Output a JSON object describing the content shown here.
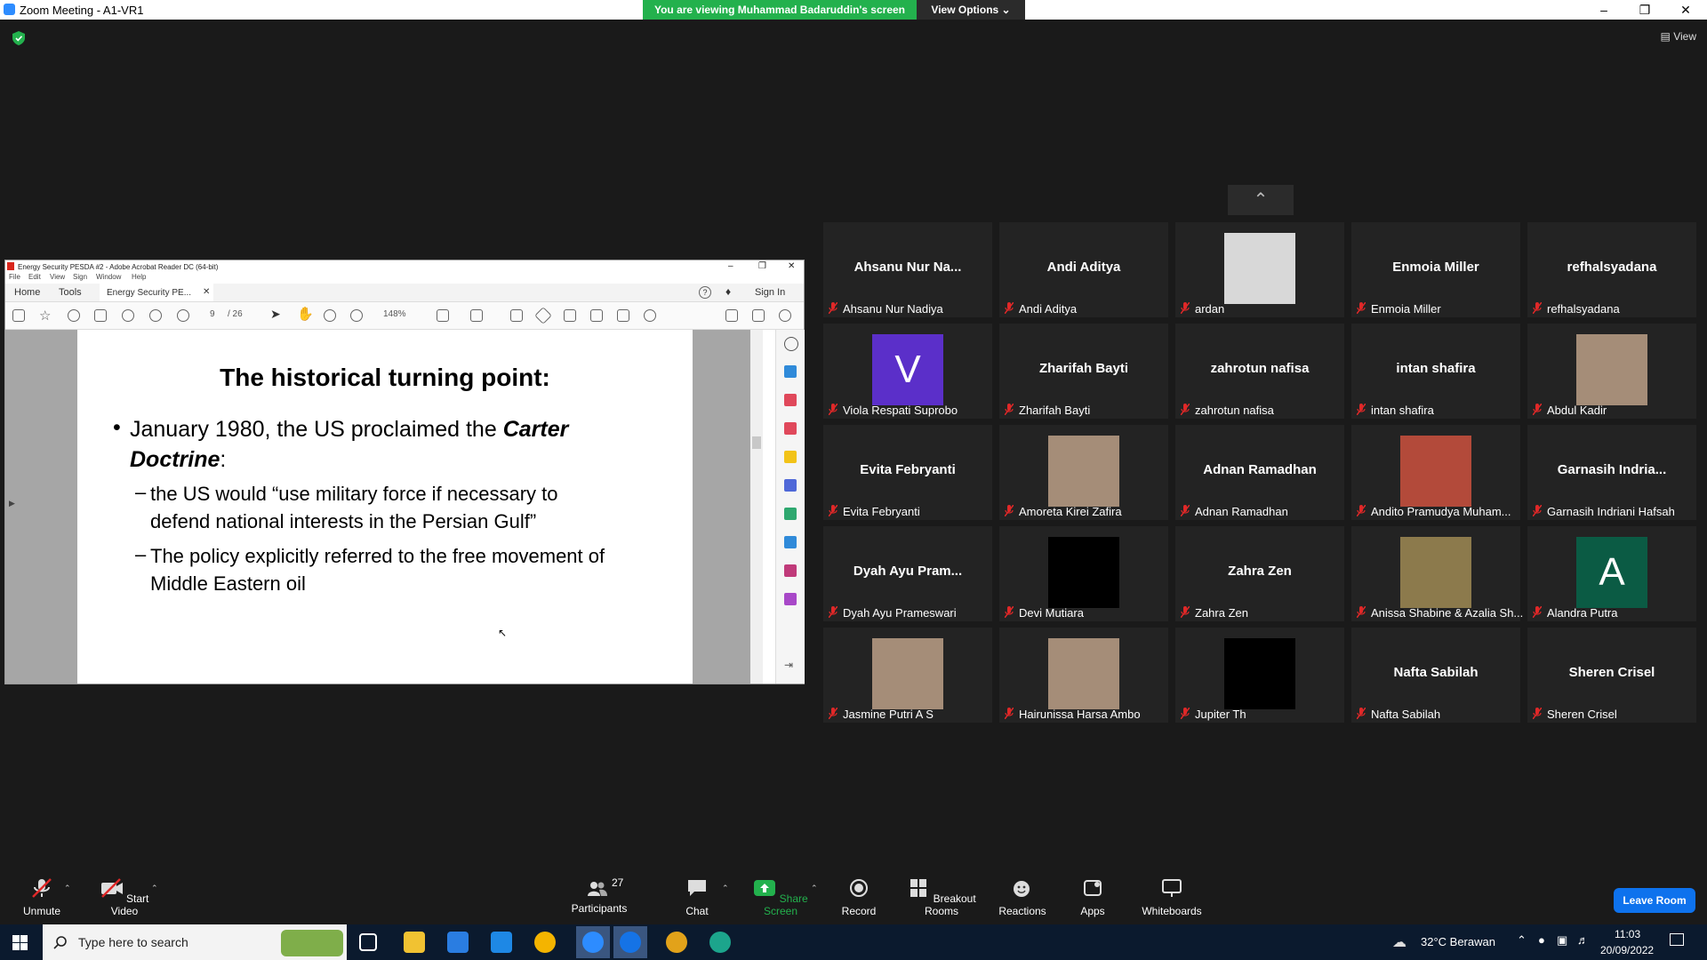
{
  "window": {
    "title": "Zoom Meeting - A1-VR1"
  },
  "banner": {
    "viewing": "You are viewing Muhammad Badaruddin's screen",
    "view_options": "View Options"
  },
  "top_right": {
    "view": "View"
  },
  "acrobat": {
    "title": "Energy Security PESDA #2 - Adobe Acrobat Reader DC (64-bit)",
    "menu": [
      "File",
      "Edit",
      "View",
      "Sign",
      "Window",
      "Help"
    ],
    "tabs": {
      "home": "Home",
      "tools": "Tools",
      "doc": "Energy Security PE..."
    },
    "sign_in": "Sign In",
    "page_current": "9",
    "page_total": "/ 26",
    "zoom": "148%"
  },
  "slide": {
    "title": "The historical turning point:",
    "bullet1a": "January 1980, the US proclaimed the ",
    "bullet1b": "Carter",
    "bullet1c": "Doctrine",
    "bullet1d": ":",
    "sub1a": "the US would “use military force if necessary to",
    "sub1b": "defend national interests in the Persian Gulf”",
    "sub2a": "The policy explicitly referred to the free movement of",
    "sub2b": "Middle Eastern oil"
  },
  "participants": [
    {
      "big": "Ahsanu Nur Na...",
      "name": "Ahsanu Nur Nadiya"
    },
    {
      "big": "Andi Aditya",
      "name": "Andi Aditya"
    },
    {
      "big": "",
      "name": "ardan",
      "video": "paper-photo"
    },
    {
      "big": "Enmoia Miller",
      "name": "Enmoia Miller"
    },
    {
      "big": "refhalsyadana",
      "name": "refhalsyadana"
    },
    {
      "big": "",
      "name": "Viola Respati Suprobo",
      "avatar": "V",
      "avatar_color": "#5b2fc9"
    },
    {
      "big": "Zharifah Bayti",
      "name": "Zharifah Bayti"
    },
    {
      "big": "zahrotun nafisa",
      "name": "zahrotun nafisa"
    },
    {
      "big": "intan shafira",
      "name": "intan shafira"
    },
    {
      "big": "",
      "name": "Abdul Kadir",
      "video": "face-photo"
    },
    {
      "big": "Evita Febryanti",
      "name": "Evita Febryanti"
    },
    {
      "big": "",
      "name": "Amoreta Kirei Zafira",
      "video": "face-photo"
    },
    {
      "big": "Adnan Ramadhan",
      "name": "Adnan Ramadhan"
    },
    {
      "big": "",
      "name": "Andito Pramudya Muham...",
      "video": "poster-photo"
    },
    {
      "big": "Garnasih  Indria...",
      "name": "Garnasih Indriani Hafsah"
    },
    {
      "big": "Dyah Ayu Pram...",
      "name": "Dyah Ayu Prameswari"
    },
    {
      "big": "",
      "name": "Devi Mutiara",
      "video": "black"
    },
    {
      "big": "Zahra Zen",
      "name": "Zahra Zen"
    },
    {
      "big": "",
      "name": "Anissa Shabine & Azalia Sh...",
      "video": "people-photo"
    },
    {
      "big": "",
      "name": "Alandra Putra",
      "avatar": "A",
      "avatar_color": "#0b5b44"
    },
    {
      "big": "",
      "name": "Jasmine Putri A S",
      "video": "face-photo"
    },
    {
      "big": "",
      "name": "Hairunissa Harsa Ambo",
      "video": "face-photo"
    },
    {
      "big": "",
      "name": "Jupiter Th",
      "video": "black"
    },
    {
      "big": "Nafta Sabilah",
      "name": "Nafta Sabilah"
    },
    {
      "big": "Sheren Crisel",
      "name": "Sheren Crisel"
    }
  ],
  "toolbar": {
    "unmute": "Unmute",
    "start_video": "Start Video",
    "participants": "Participants",
    "participants_count": "27",
    "chat": "Chat",
    "share": "Share Screen",
    "record": "Record",
    "breakout": "Breakout Rooms",
    "reactions": "Reactions",
    "apps": "Apps",
    "whiteboards": "Whiteboards",
    "leave": "Leave Room"
  },
  "taskbar": {
    "search_placeholder": "Type here to search",
    "weather": "32°C  Berawan",
    "time": "11:03",
    "date": "20/09/2022"
  },
  "colors": {
    "share_green": "#23b14d",
    "leave_blue": "#0e72ed",
    "mic_red": "#e02828"
  }
}
